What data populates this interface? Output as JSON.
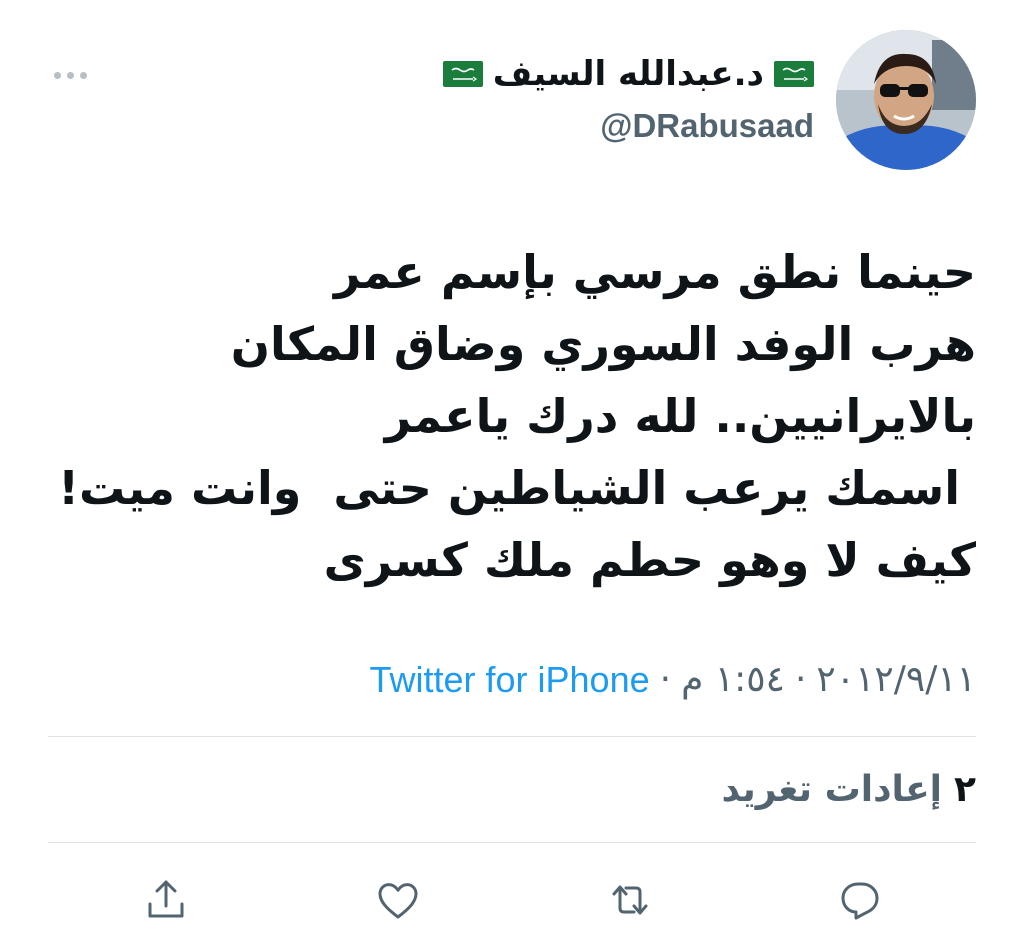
{
  "author": {
    "display_name": "د.عبدالله السيف",
    "handle": "@DRabusaad"
  },
  "tweet": {
    "lines": [
      "حينما نطق مرسي بإسم عمر",
      "هرب الوفد السوري وضاق المكان",
      "بالايرانيين.. لله درك ياعمر",
      " اسمك يرعب الشياطين حتى  وانت ميت!",
      "كيف لا وهو حطم ملك كسرى"
    ]
  },
  "meta": {
    "date": "٢٠١٢/٩/١١",
    "separator": "·",
    "time": "١:٥٤ م",
    "source": "Twitter for iPhone"
  },
  "stats": {
    "retweets_count": "٢",
    "retweets_label": "إعادات تغريد"
  },
  "icons": {
    "more": "more-horizontal-icon",
    "reply": "reply-icon",
    "retweet": "retweet-icon",
    "like": "heart-icon",
    "share": "share-icon",
    "flag": "saudi-flag-icon"
  },
  "colors": {
    "accent": "#1d9bf0",
    "secondary_text": "#536471",
    "icon": "#536471",
    "divider": "#dfe3e6",
    "flag_green": "#1a7d3c"
  }
}
